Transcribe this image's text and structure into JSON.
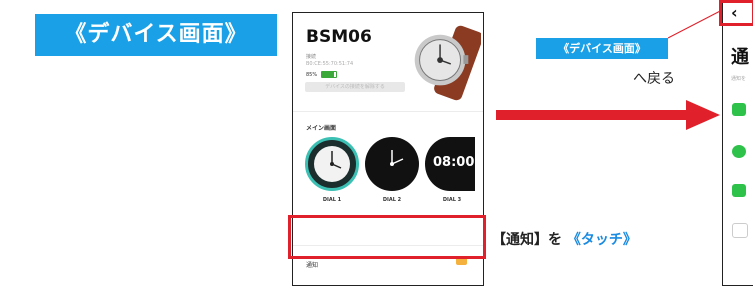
{
  "title_badge": "《デバイス画面》",
  "device": {
    "name": "BSM06",
    "label": "接続",
    "mac": "B0:CE:55:70:51:74",
    "battery": "85%",
    "battery_level": 0.85,
    "manage_button": "デバイスの接続を解除する"
  },
  "main_screen_title": "メイン画面",
  "dials": [
    "DIAL 1",
    "DIAL 2",
    "DIAL 3"
  ],
  "dial3_time": "08:00",
  "notify_label": "通知",
  "tap_instruction": {
    "prefix": "【通知】を",
    "emphasis": "《タッチ》"
  },
  "return_badge": "《デバイス画面》",
  "return_text": "へ戻る",
  "right_screen": {
    "title": "通",
    "subtitle": "通知を"
  },
  "colors": {
    "accent_blue": "#1aa0e6",
    "highlight_red": "#e0202a",
    "notify_orange": "#f4b13d"
  }
}
